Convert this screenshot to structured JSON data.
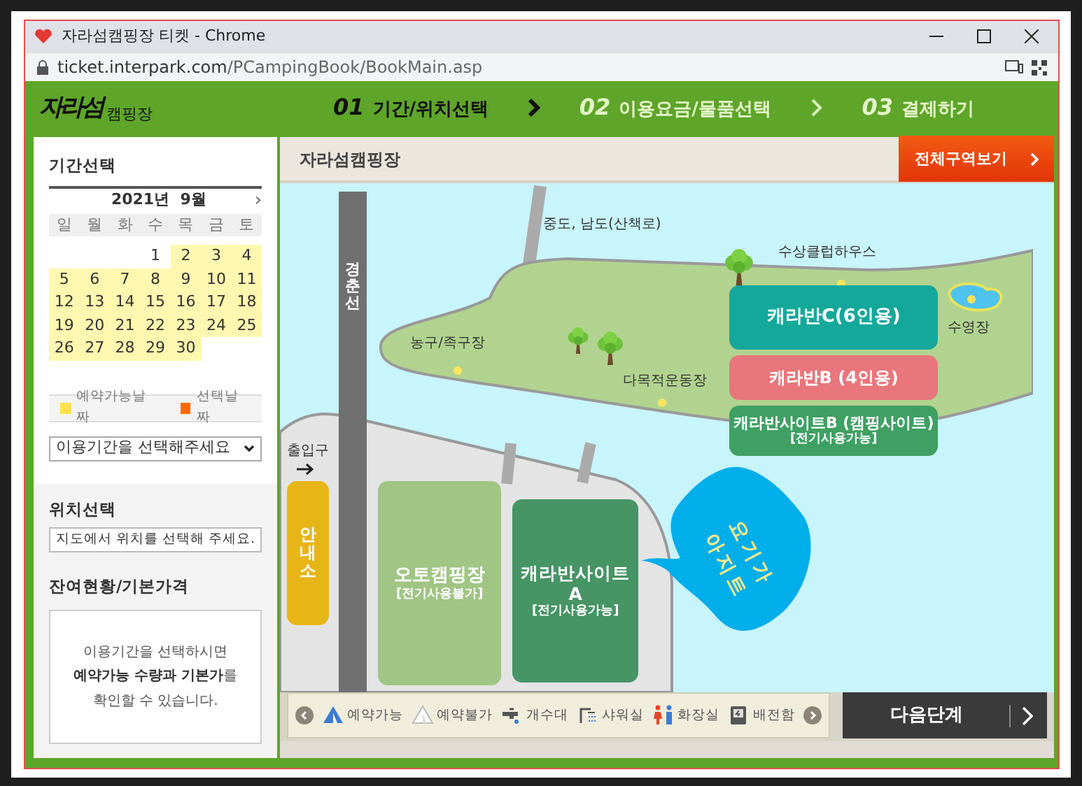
{
  "browser": {
    "title": "자라섬캠핑장 티켓 - Chrome",
    "url_host": "ticket.interpark.com",
    "url_path": "/PCampingBook/BookMain.asp"
  },
  "header": {
    "logo_script": "자라섬",
    "logo_caption": "캠핑장",
    "steps": [
      {
        "number": "01",
        "label": "기간/위치선택",
        "selected": true
      },
      {
        "number": "02",
        "label": "이용요금/물품선택",
        "selected": false
      },
      {
        "number": "03",
        "label": "결제하기",
        "selected": false
      }
    ]
  },
  "sidebar": {
    "period": {
      "heading": "기간선택",
      "month": "2021년  9월",
      "next": "›",
      "weekdays": [
        "일",
        "월",
        "화",
        "수",
        "목",
        "금",
        "토"
      ],
      "weeks": [
        [
          {
            "label": "1",
            "available": false
          },
          {
            "label": "2",
            "available": true
          },
          {
            "label": "3",
            "available": true
          },
          {
            "label": "4",
            "available": true
          }
        ],
        [
          {
            "label": "5",
            "available": true
          },
          {
            "label": "6",
            "available": true
          },
          {
            "label": "7",
            "available": true
          },
          {
            "label": "8",
            "available": true
          },
          {
            "label": "9",
            "available": true
          },
          {
            "label": "10",
            "available": true
          },
          {
            "label": "11",
            "available": true
          }
        ],
        [
          {
            "label": "12",
            "available": true
          },
          {
            "label": "13",
            "available": true
          },
          {
            "label": "14",
            "available": true
          },
          {
            "label": "15",
            "available": true
          },
          {
            "label": "16",
            "available": true
          },
          {
            "label": "17",
            "available": true
          },
          {
            "label": "18",
            "available": true
          }
        ],
        [
          {
            "label": "19",
            "available": true
          },
          {
            "label": "20",
            "available": true
          },
          {
            "label": "21",
            "available": true
          },
          {
            "label": "22",
            "available": true
          },
          {
            "label": "23",
            "available": true
          },
          {
            "label": "24",
            "available": true
          },
          {
            "label": "25",
            "available": true
          }
        ],
        [
          {
            "label": "26",
            "available": true
          },
          {
            "label": "27",
            "available": true
          },
          {
            "label": "28",
            "available": true
          },
          {
            "label": "29",
            "available": true
          },
          {
            "label": "30",
            "available": true
          }
        ]
      ],
      "legend": [
        {
          "label": "예약가능날짜",
          "color": "#ffe14d"
        },
        {
          "label": "선택날짜",
          "color": "#ff6a00"
        }
      ],
      "select": {
        "value": "이용기간을 선택해주세요"
      }
    },
    "location": {
      "heading": "위치선택",
      "value": "지도에서 위치를 선택해 주세요."
    },
    "availability": {
      "heading": "잔여현황/기본가격",
      "message": "이용기간을 선택하시면\n**예약가능 수량과 기본가**를\n확인할 수 있습니다."
    }
  },
  "map": {
    "title": "자라섬캠핑장",
    "all_button": "전체구역보기",
    "rail_label": "경춘선",
    "entrance": "출입구",
    "info": "안내소",
    "places": [
      {
        "label": "중도, 남도(산책로)"
      },
      {
        "label": "수상클럽하우스"
      },
      {
        "label": "수영장"
      },
      {
        "label": "농구/족구장"
      },
      {
        "label": "다목적운동장"
      }
    ],
    "areas": [
      {
        "label": "캐라반C(6인용)",
        "color": "#14a89b"
      },
      {
        "label": "캐라반B (4인용)",
        "color": "#e8767c"
      },
      {
        "label": "캐라반사이트B (캠핑사이트)",
        "sublabel": "[전기사용가능]",
        "color": "#3fa064"
      },
      {
        "label": "오토캠핑장",
        "sublabel": "[전기사용불가]",
        "color": "#a0c584"
      },
      {
        "label": "캐라반사이트 A",
        "sublabel": "[전기사용가능]",
        "color": "#479465"
      }
    ],
    "callout": [
      "요기가",
      "아지트"
    ],
    "legend": [
      {
        "kind": "tent-open",
        "label": "예약가능"
      },
      {
        "kind": "tent-closed",
        "label": "예약불가"
      },
      {
        "kind": "faucet",
        "label": "개수대"
      },
      {
        "kind": "shower",
        "label": "샤워실"
      },
      {
        "kind": "toilet",
        "label": "화장실"
      },
      {
        "kind": "panel",
        "label": "배전함"
      }
    ],
    "next_button": "다음단계"
  }
}
